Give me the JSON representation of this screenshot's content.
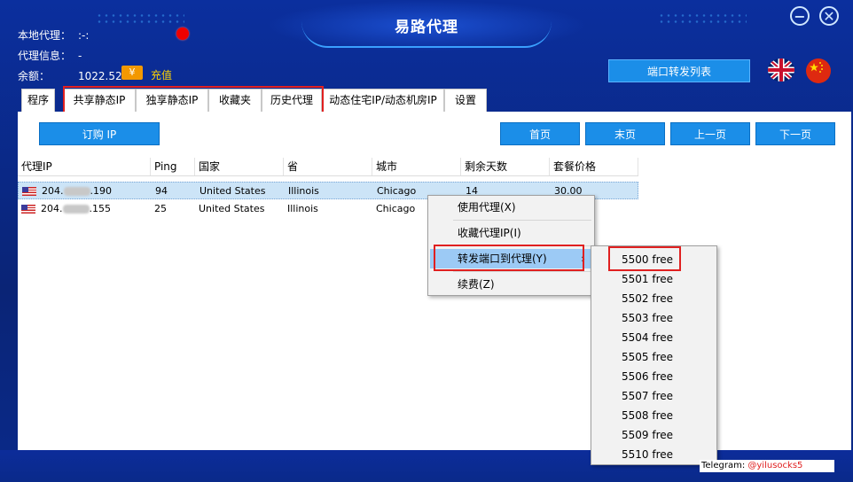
{
  "app": {
    "title": "易路代理",
    "minimize_glyph": "−",
    "close_glyph": "✕"
  },
  "info": {
    "local_proxy_label": "本地代理：",
    "local_proxy_value": ":-:",
    "proxy_info_label": "代理信息：",
    "proxy_info_value": "-",
    "balance_label": "余额：",
    "balance_value": "1022.52",
    "currency_icon": "¥",
    "recharge_label": "充值"
  },
  "header": {
    "port_forward_list_label": "端口转发列表"
  },
  "tabs": [
    {
      "label": "程序"
    },
    {
      "label": "共享静态IP"
    },
    {
      "label": "独享静态IP"
    },
    {
      "label": "收藏夹"
    },
    {
      "label": "历史代理"
    },
    {
      "label": "动态住宅IP/动态机房IP"
    },
    {
      "label": "设置"
    }
  ],
  "toolbar": {
    "buy_ip_label": "订购 IP",
    "first_page_label": "首页",
    "last_page_label": "末页",
    "prev_page_label": "上一页",
    "next_page_label": "下一页"
  },
  "table": {
    "columns": [
      "代理IP",
      "Ping",
      "国家",
      "省",
      "城市",
      "剩余天数",
      "套餐价格"
    ],
    "rows": [
      {
        "ip_prefix": "204.",
        "ip_suffix": ".190",
        "ping": "94",
        "country": "United States",
        "state": "Illinois",
        "city": "Chicago",
        "days": "14",
        "price": "30.00"
      },
      {
        "ip_prefix": "204.",
        "ip_suffix": ".155",
        "ping": "25",
        "country": "United States",
        "state": "Illinois",
        "city": "Chicago",
        "days": "",
        "price": ""
      }
    ]
  },
  "context_menu": {
    "items": [
      {
        "label": "使用代理(X)"
      },
      {
        "label": "收藏代理IP(I)"
      },
      {
        "label": "转发端口到代理(Y)"
      },
      {
        "label": "续费(Z)"
      }
    ],
    "submenu_arrow": "›"
  },
  "submenu": {
    "items": [
      "5500 free",
      "5501 free",
      "5502 free",
      "5503 free",
      "5504 free",
      "5505 free",
      "5506 free",
      "5507 free",
      "5508 free",
      "5509 free",
      "5510 free"
    ]
  },
  "footer": {
    "telegram_label": "Telegram:",
    "telegram_handle": "@yilusocks5"
  },
  "colors": {
    "accent": "#1b8ee8",
    "highlight_box": "#e02020",
    "background": "#0a2a8a"
  }
}
